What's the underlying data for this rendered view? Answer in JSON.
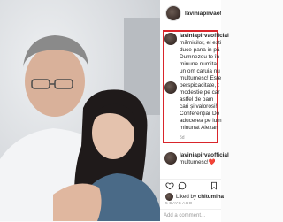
{
  "post": {
    "username": "laviniapirvaofficial",
    "comments": [
      {
        "username": "laviniapirvaofficial",
        "lines": [
          "mămicilor, el ești",
          "duce pana in pă",
          "Dumnezeu te în",
          "minune numita",
          "un om caruia nu",
          "multumesc! Este",
          "perspicacitate, t",
          "modestie pe car",
          "astfel de oam",
          "cari și valorosi!",
          "Conferențiar Do",
          "aducerea pe lum",
          "minunat Alexan"
        ],
        "meta": "5d"
      },
      {
        "username": "laviniapirvaofficial",
        "text": "multumesc!❤️"
      }
    ],
    "likes_prefix": "Liked by",
    "liked_by": "chitumiha",
    "age": "5 DAYS AGO",
    "add_comment_placeholder": "Add a comment..."
  },
  "colors": {
    "highlight": "#d9252b",
    "text": "#262626",
    "muted": "#8e8e8e"
  }
}
